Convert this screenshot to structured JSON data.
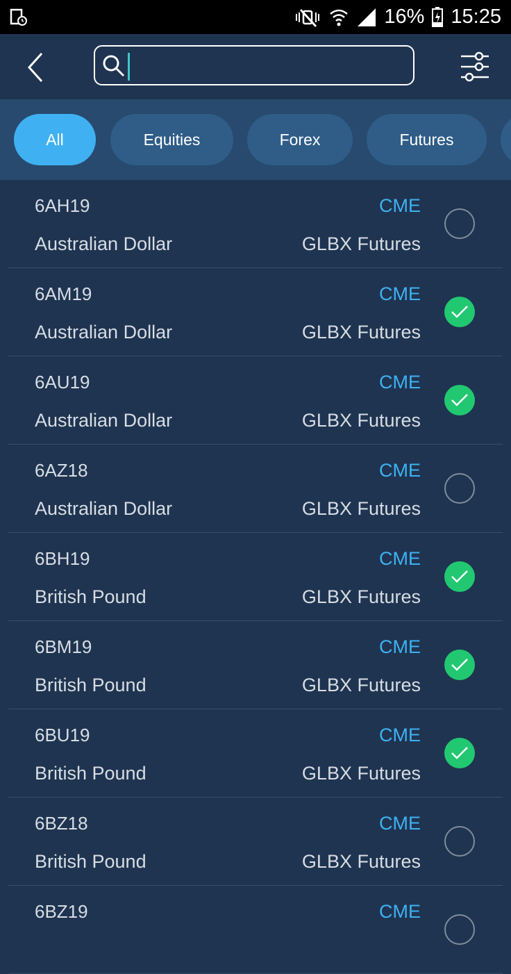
{
  "status_bar": {
    "battery": "16%",
    "time": "15:25"
  },
  "header": {
    "search": {
      "value": "",
      "placeholder": ""
    }
  },
  "tabs": [
    {
      "label": "All",
      "active": true
    },
    {
      "label": "Equities",
      "active": false
    },
    {
      "label": "Forex",
      "active": false
    },
    {
      "label": "Futures",
      "active": false
    }
  ],
  "instruments": [
    {
      "symbol": "6AH19",
      "exchange": "CME",
      "name": "Australian Dollar",
      "market": "GLBX Futures",
      "selected": false
    },
    {
      "symbol": "6AM19",
      "exchange": "CME",
      "name": "Australian Dollar",
      "market": "GLBX Futures",
      "selected": true
    },
    {
      "symbol": "6AU19",
      "exchange": "CME",
      "name": "Australian Dollar",
      "market": "GLBX Futures",
      "selected": true
    },
    {
      "symbol": "6AZ18",
      "exchange": "CME",
      "name": "Australian Dollar",
      "market": "GLBX Futures",
      "selected": false
    },
    {
      "symbol": "6BH19",
      "exchange": "CME",
      "name": "British Pound",
      "market": "GLBX Futures",
      "selected": true
    },
    {
      "symbol": "6BM19",
      "exchange": "CME",
      "name": "British Pound",
      "market": "GLBX Futures",
      "selected": true
    },
    {
      "symbol": "6BU19",
      "exchange": "CME",
      "name": "British Pound",
      "market": "GLBX Futures",
      "selected": true
    },
    {
      "symbol": "6BZ18",
      "exchange": "CME",
      "name": "British Pound",
      "market": "GLBX Futures",
      "selected": false
    },
    {
      "symbol": "6BZ19",
      "exchange": "CME",
      "name": "",
      "market": "",
      "selected": false
    }
  ],
  "colors": {
    "background": "#1f3450",
    "tab_bar": "#274a6e",
    "tab": "#2f5d88",
    "tab_active": "#3fb1f2",
    "exchange_text": "#3fb1f2",
    "check_on": "#21c871"
  }
}
